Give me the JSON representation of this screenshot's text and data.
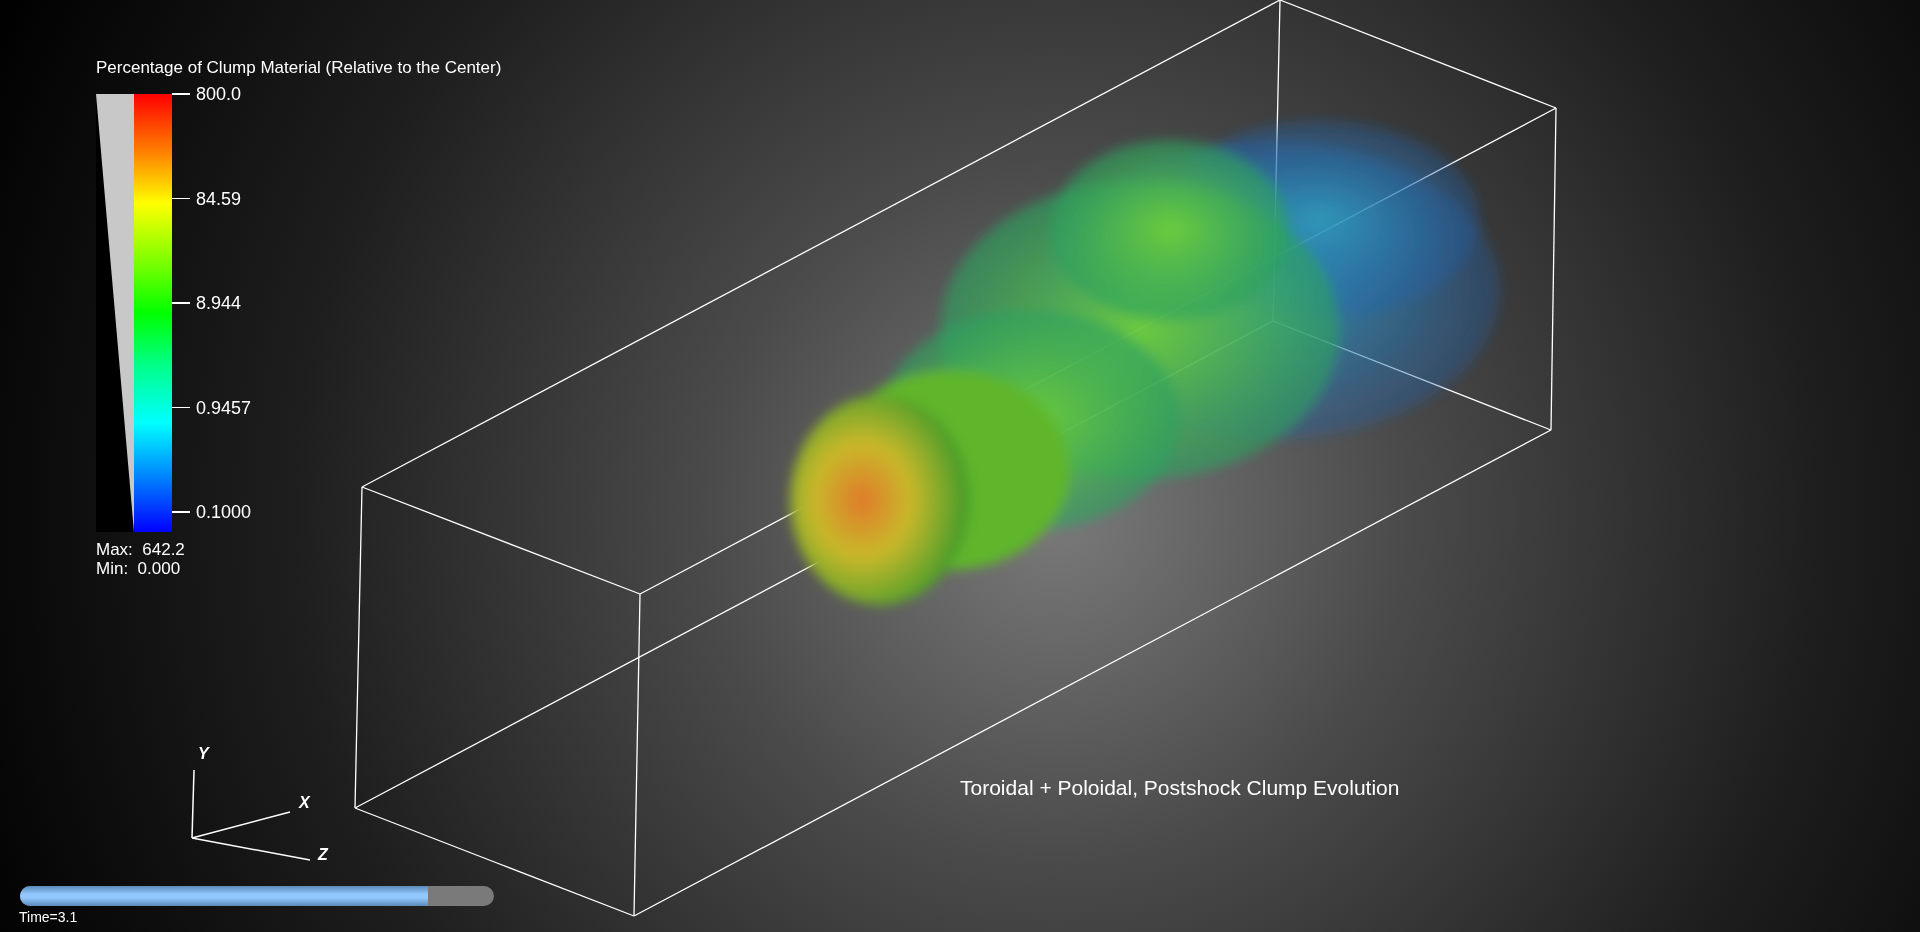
{
  "legend": {
    "title": "Percentage of Clump Material (Relative to the Center)",
    "ticks": [
      "800.0",
      "84.59",
      "8.944",
      "0.9457",
      "0.1000"
    ],
    "max": "Max:  642.2",
    "min": "Min:  0.000"
  },
  "caption": "Toroidal + Poloidal, Postshock Clump Evolution",
  "axes": [
    "Y",
    "X",
    "Z"
  ],
  "time_slider": {
    "level": 0.86,
    "label": "Time=3.1"
  }
}
